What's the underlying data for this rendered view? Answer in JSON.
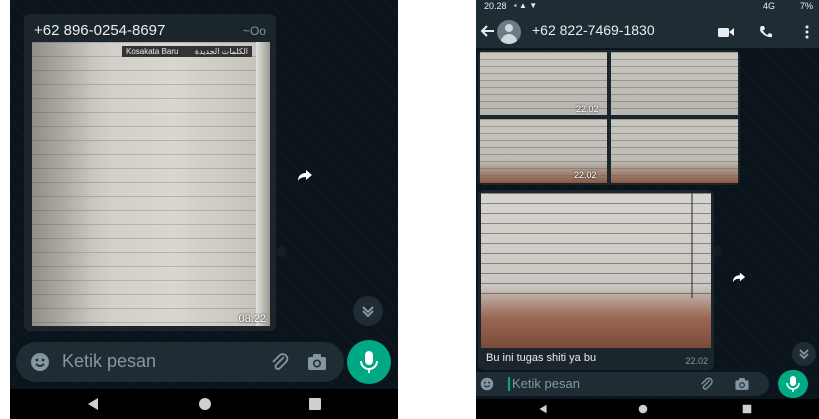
{
  "left": {
    "header_phone": "+62 896-0254-8697",
    "header_status": "~Oo",
    "book_page_header_arabic": "الكلمات الجديدة",
    "book_page_header_latin": "Kosakata Baru",
    "image_timestamp": "08.22",
    "input_placeholder": "Ketik pesan"
  },
  "right": {
    "status_time": "20.28",
    "status_signal": "4G",
    "status_battery": "7%",
    "header_phone": "+62 822-7469-1830",
    "thumb_timestamps": [
      "22.02",
      "22.02"
    ],
    "caption": "Bu ini tugas shiti ya bu",
    "caption_time": "22.02",
    "input_placeholder": "Ketik pesan"
  }
}
